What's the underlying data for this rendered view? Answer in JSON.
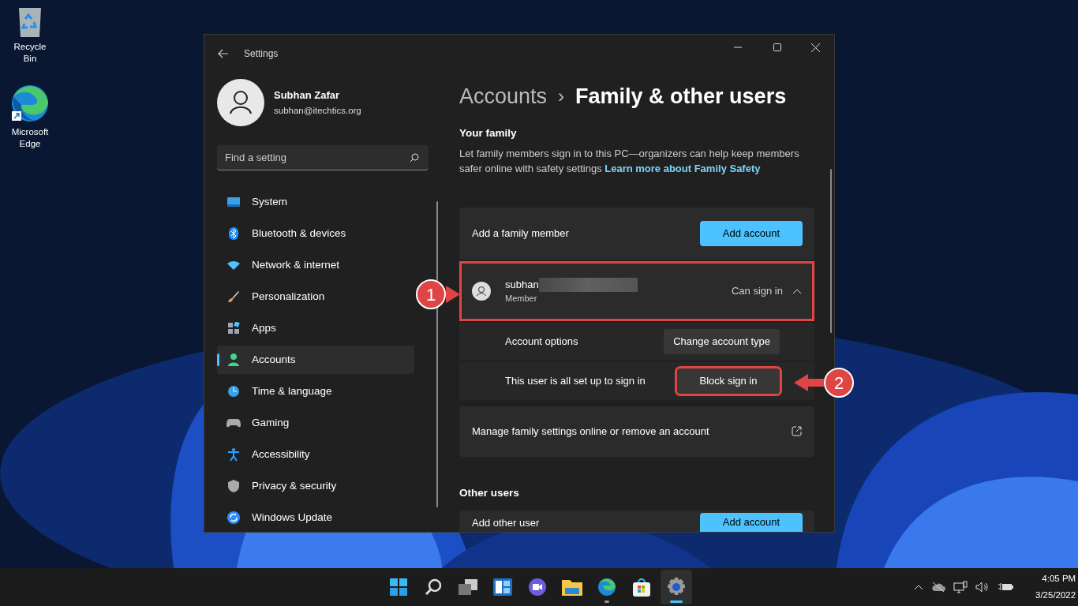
{
  "desktop_icons": [
    {
      "label": "Recycle Bin"
    },
    {
      "label": "Microsoft Edge"
    }
  ],
  "window": {
    "title": "Settings",
    "user": {
      "name": "Subhan Zafar",
      "email": "subhan@itechtics.org"
    },
    "search": {
      "placeholder": "Find a setting"
    }
  },
  "sidebar": {
    "items": [
      {
        "label": "System",
        "selected": false
      },
      {
        "label": "Bluetooth & devices",
        "selected": false
      },
      {
        "label": "Network & internet",
        "selected": false
      },
      {
        "label": "Personalization",
        "selected": false
      },
      {
        "label": "Apps",
        "selected": false
      },
      {
        "label": "Accounts",
        "selected": true
      },
      {
        "label": "Time & language",
        "selected": false
      },
      {
        "label": "Gaming",
        "selected": false
      },
      {
        "label": "Accessibility",
        "selected": false
      },
      {
        "label": "Privacy & security",
        "selected": false
      },
      {
        "label": "Windows Update",
        "selected": false
      }
    ]
  },
  "breadcrumb": {
    "parent": "Accounts",
    "separator": "›",
    "current": "Family & other users"
  },
  "your_family": {
    "heading": "Your family",
    "description": "Let family members sign in to this PC—organizers can help keep members safer online with safety settings",
    "link": "Learn more about Family Safety",
    "add_member": {
      "label": "Add a family member",
      "button": "Add account"
    },
    "member": {
      "name": "subhan",
      "role": "Member",
      "status": "Can sign in",
      "expanded": true,
      "highlighted": true,
      "options": [
        {
          "label": "Account options",
          "button": "Change account type",
          "highlighted": false
        },
        {
          "label": "This user is all set up to sign in",
          "button": "Block sign in",
          "highlighted": true
        }
      ]
    },
    "manage": {
      "label": "Manage family settings online or remove an account"
    }
  },
  "other_users": {
    "heading": "Other users",
    "add_user": {
      "label": "Add other user",
      "button": "Add account"
    }
  },
  "annotations": [
    {
      "number": "1"
    },
    {
      "number": "2"
    }
  ],
  "taskbar": {
    "apps": [
      {
        "running": false,
        "selected": false
      },
      {
        "running": false,
        "selected": false
      },
      {
        "running": false,
        "selected": false
      },
      {
        "running": false,
        "selected": false
      },
      {
        "running": false,
        "selected": false
      },
      {
        "running": false,
        "selected": false
      },
      {
        "running": true,
        "selected": false
      },
      {
        "running": false,
        "selected": false
      },
      {
        "running": true,
        "selected": true
      }
    ]
  },
  "clock": {
    "time": "4:05 PM",
    "date": "3/25/2022"
  }
}
